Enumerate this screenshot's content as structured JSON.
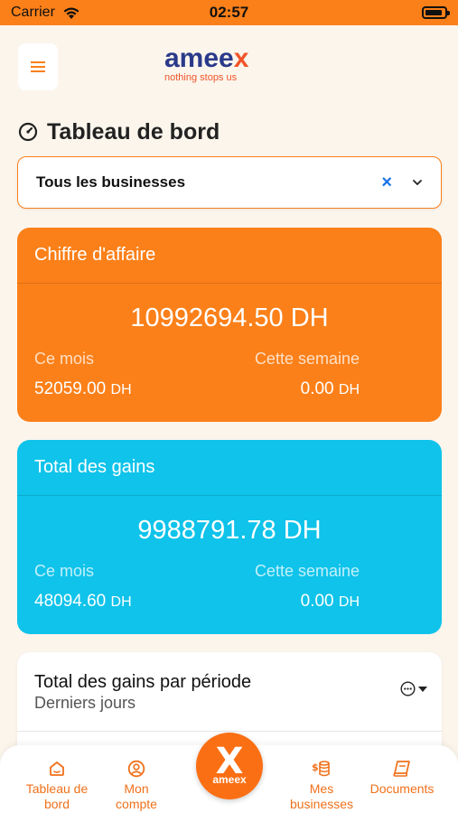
{
  "status": {
    "carrier": "Carrier",
    "time": "02:57"
  },
  "logo": {
    "word_main": "amee",
    "word_x": "x",
    "tagline": "nothing stops us"
  },
  "page": {
    "title": "Tableau de bord"
  },
  "business_select": {
    "value": "Tous les businesses",
    "clear": "×"
  },
  "revenue_card": {
    "title": "Chiffre d'affaire",
    "total": "10992694.50 DH",
    "month_label": "Ce mois",
    "week_label": "Cette semaine",
    "month_value": "52059.00",
    "week_value": "0.00",
    "unit": "DH"
  },
  "gains_card": {
    "title": "Total des gains",
    "total": "9988791.78 DH",
    "month_label": "Ce mois",
    "week_label": "Cette semaine",
    "month_value": "48094.60",
    "week_value": "0.00",
    "unit": "DH"
  },
  "period_card": {
    "title": "Total des gains par période",
    "subtitle": "Derniers jours"
  },
  "tabbar": {
    "items": [
      {
        "label_line1": "Tableau de",
        "label_line2": "bord",
        "icon": "home-icon"
      },
      {
        "label_line1": "Mon",
        "label_line2": "compte",
        "icon": "user-circle-icon"
      },
      {
        "label_line1": "Mes",
        "label_line2": "businesses",
        "icon": "coins-icon"
      },
      {
        "label_line1": "Documents",
        "label_line2": "",
        "icon": "documents-icon"
      }
    ],
    "fab": {
      "glyph": "X",
      "word": "ameex"
    }
  },
  "colors": {
    "orange": "#fb8019",
    "blue": "#0fc3ea",
    "navy": "#2a3a8a",
    "background": "#fbf5ec"
  }
}
